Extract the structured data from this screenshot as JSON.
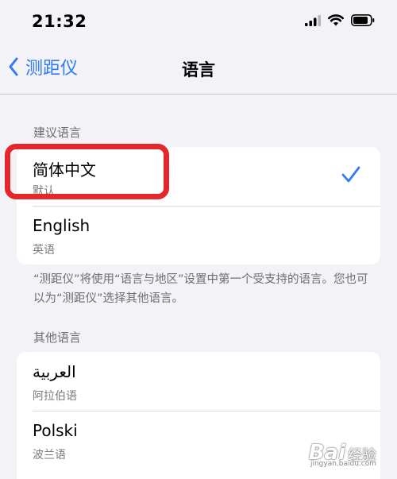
{
  "status_bar": {
    "time": "21:32"
  },
  "nav": {
    "back_label": "测距仪",
    "title": "语言"
  },
  "suggested": {
    "header": "建议语言",
    "items": [
      {
        "title": "简体中文",
        "subtitle": "默认",
        "selected": true
      },
      {
        "title": "English",
        "subtitle": "英语",
        "selected": false
      }
    ],
    "footnote": "“测距仪”将使用“语言与地区”设置中第一个受支持的语言。您也可以为“测距仪”选择其他语言。"
  },
  "other": {
    "header": "其他语言",
    "items": [
      {
        "title": "العربية",
        "subtitle": "阿拉伯语"
      },
      {
        "title": "Polski",
        "subtitle": "波兰语"
      }
    ]
  },
  "watermark": {
    "logo": "Bai",
    "text": "经验",
    "url": "jingyan.baidu.com"
  },
  "colors": {
    "accent": "#2f7cf6",
    "highlight": "#e4262d",
    "background": "#f2f2f7"
  },
  "icons": [
    "signal-icon",
    "wifi-icon",
    "battery-icon",
    "chevron-left-icon",
    "checkmark-icon"
  ]
}
